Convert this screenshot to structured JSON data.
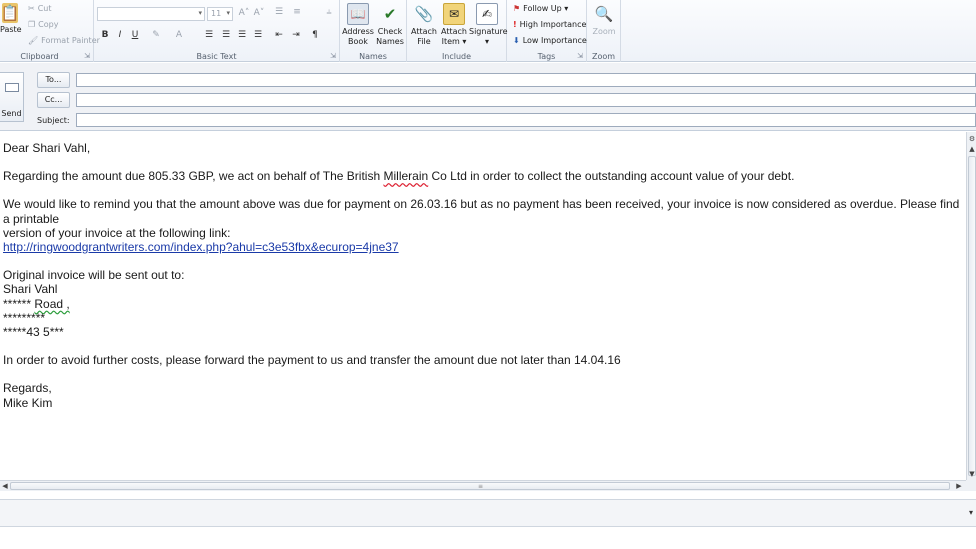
{
  "ribbon": {
    "clipboard": {
      "label": "Clipboard",
      "paste": "Paste",
      "cut": "Cut",
      "copy": "Copy",
      "format_painter": "Format Painter"
    },
    "basic_text": {
      "label": "Basic Text",
      "font_size": "11"
    },
    "names": {
      "label": "Names",
      "address_book": [
        "Address",
        "Book"
      ],
      "check_names": [
        "Check",
        "Names"
      ]
    },
    "include": {
      "label": "Include",
      "attach_file": [
        "Attach",
        "File"
      ],
      "attach_item": [
        "Attach",
        "Item ▾"
      ],
      "signature": [
        "Signature",
        "▾"
      ]
    },
    "tags": {
      "label": "Tags",
      "follow_up": "Follow Up ▾",
      "high_importance": "High Importance",
      "low_importance": "Low Importance"
    },
    "zoom": {
      "label": "Zoom",
      "zoom": "Zoom"
    }
  },
  "header": {
    "send": "Send",
    "to": "To...",
    "cc": "Cc...",
    "subject": "Subject:"
  },
  "email": {
    "greeting": "Dear Shari Vahl,",
    "p1_a": "Regarding the amount due 805.33 GBP, we act on behalf of The British ",
    "p1_company": "Millerain",
    "p1_b": " Co Ltd in order to collect the outstanding account value of your debt.",
    "p2_line1": "We would like to remind you that the amount above was due for payment on 26.03.16 but as no payment has been received, your invoice is now considered as overdue. Please find a printable",
    "p2_line2": "version of your invoice at the following link:",
    "link": "http://ringwoodgrantwriters.com/index.php?ahul=c3e53fbx&ecurop=4jne37",
    "address_intro": "Original invoice will be sent out to:",
    "address_name": "Shari Vahl",
    "address_line1_a": "****** ",
    "address_line1_b": "Road ,",
    "address_line2": "*********",
    "address_line3": "*****43 5***",
    "p3": "In order to avoid further costs, please forward the payment to us and transfer the amount due not later than 14.04.16",
    "signoff": "Regards,",
    "signature": "Mike Kim"
  },
  "colors": {
    "link": "#1a3aa8",
    "ribbon_bg": "#eef2f8",
    "grammar_squiggle": "#2e9e3e"
  }
}
